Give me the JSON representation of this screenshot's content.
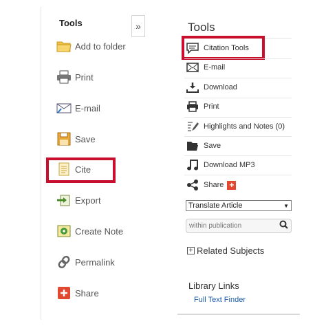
{
  "left_panel": {
    "title": "Tools",
    "collapse_icon": "»",
    "items": [
      {
        "label": "Add to folder",
        "icon": "folder-icon"
      },
      {
        "label": "Print",
        "icon": "printer-icon"
      },
      {
        "label": "E-mail",
        "icon": "email-icon"
      },
      {
        "label": "Save",
        "icon": "save-icon"
      },
      {
        "label": "Cite",
        "icon": "cite-icon"
      },
      {
        "label": "Export",
        "icon": "export-icon"
      },
      {
        "label": "Create Note",
        "icon": "note-icon"
      },
      {
        "label": "Permalink",
        "icon": "link-icon"
      },
      {
        "label": "Share",
        "icon": "share-icon"
      }
    ]
  },
  "right_panel": {
    "title": "Tools",
    "items": [
      {
        "label": "Citation Tools",
        "icon": "citation-icon"
      },
      {
        "label": "E-mail",
        "icon": "envelope-icon"
      },
      {
        "label": "Download",
        "icon": "download-icon"
      },
      {
        "label": "Print",
        "icon": "printer-icon"
      },
      {
        "label": "Highlights and Notes (0)",
        "icon": "highlight-icon"
      },
      {
        "label": "Save",
        "icon": "folder-icon"
      },
      {
        "label": "Download MP3",
        "icon": "music-icon"
      },
      {
        "label": "Share",
        "icon": "share-icon"
      }
    ],
    "share_plus": "+",
    "translate": {
      "selected": "Translate Article",
      "arrow": "▼"
    },
    "search": {
      "placeholder": "within publication"
    },
    "related_subjects": {
      "toggle": "+",
      "label": "Related Subjects"
    },
    "library_links": {
      "title": "Library Links",
      "link": "Full Text Finder"
    }
  },
  "colors": {
    "highlight": "#c8102e",
    "link": "#1a5da8",
    "share_badge": "#e0492f"
  }
}
